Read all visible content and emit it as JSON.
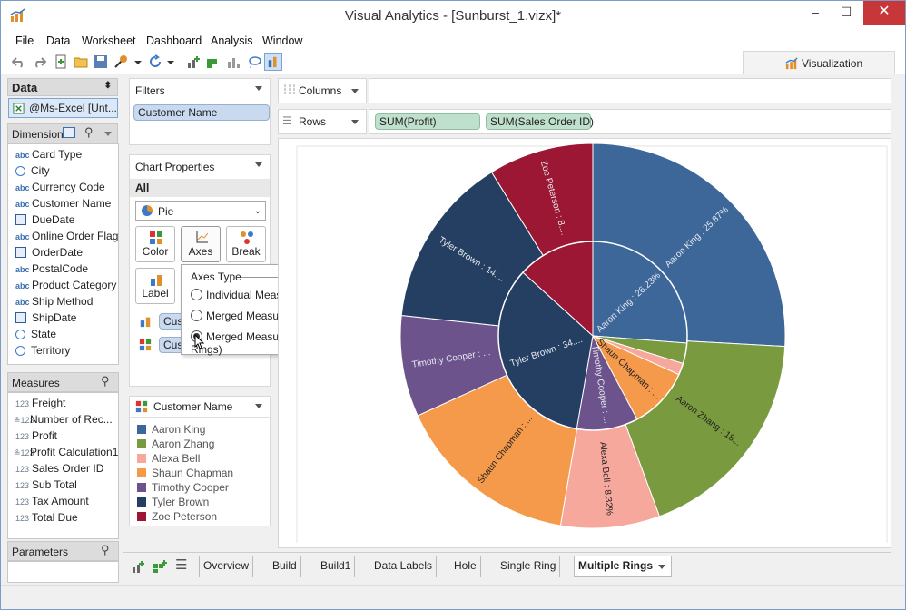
{
  "window": {
    "title": "Visual Analytics - [Sunburst_1.vizx]*",
    "minimize": "–",
    "maximize": "☐",
    "close": "✕"
  },
  "menu": [
    "File",
    "Data",
    "Worksheet",
    "Dashboard",
    "Analysis",
    "Window"
  ],
  "viz_tab": {
    "label": "Visualization"
  },
  "data_panel": {
    "title": "Data",
    "source": "@Ms-Excel [Unt..."
  },
  "dimensions": {
    "title": "Dimensions",
    "items": [
      {
        "label": "Card Type",
        "type": "abc"
      },
      {
        "label": "City",
        "type": "geo"
      },
      {
        "label": "Currency Code",
        "type": "abc"
      },
      {
        "label": "Customer Name",
        "type": "abc"
      },
      {
        "label": "DueDate",
        "type": "date"
      },
      {
        "label": "Online Order Flag",
        "type": "abc"
      },
      {
        "label": "OrderDate",
        "type": "date"
      },
      {
        "label": "PostalCode",
        "type": "abc"
      },
      {
        "label": "Product Category",
        "type": "abc"
      },
      {
        "label": "Ship Method",
        "type": "abc"
      },
      {
        "label": "ShipDate",
        "type": "date"
      },
      {
        "label": "State",
        "type": "geo"
      },
      {
        "label": "Territory",
        "type": "geo"
      }
    ]
  },
  "measures": {
    "title": "Measures",
    "items": [
      {
        "label": "Freight",
        "type": "123"
      },
      {
        "label": "Number of Rec...",
        "type": "calc"
      },
      {
        "label": "Profit",
        "type": "123"
      },
      {
        "label": "Profit Calculation1",
        "type": "calc"
      },
      {
        "label": "Sales Order ID",
        "type": "123"
      },
      {
        "label": "Sub Total",
        "type": "123"
      },
      {
        "label": "Tax Amount",
        "type": "123"
      },
      {
        "label": "Total Due",
        "type": "123"
      }
    ]
  },
  "parameters": {
    "title": "Parameters"
  },
  "filters": {
    "title": "Filters",
    "items": [
      "Customer Name"
    ]
  },
  "chart_properties": {
    "title": "Chart Properties",
    "scope": "All",
    "chart_type": "Pie",
    "buttons": {
      "color": "Color",
      "axes": "Axes",
      "break": "Break",
      "label": "Label"
    },
    "marks": [
      "Cust",
      "Cust"
    ]
  },
  "axes_popup": {
    "title": "Axes Type",
    "options": [
      {
        "label": "Individual Measures",
        "selected": false
      },
      {
        "label": "Merged Measures (Single Ring)",
        "selected": false
      },
      {
        "label": "Merged Measures (Multiple Rings)",
        "selected": true
      }
    ]
  },
  "legend": {
    "title": "Customer Name",
    "items": [
      {
        "label": "Aaron King",
        "color": "#3d6699"
      },
      {
        "label": "Aaron Zhang",
        "color": "#799a3e"
      },
      {
        "label": "Alexa Bell",
        "color": "#f5a89b"
      },
      {
        "label": "Shaun Chapman",
        "color": "#f5994a"
      },
      {
        "label": "Timothy Cooper",
        "color": "#6c538c"
      },
      {
        "label": "Tyler Brown",
        "color": "#253f63"
      },
      {
        "label": "Zoe Peterson",
        "color": "#9b1733"
      }
    ]
  },
  "shelves": {
    "columns_label": "Columns",
    "rows_label": "Rows",
    "rows_pills": [
      "SUM(Profit)",
      "SUM(Sales Order ID)"
    ]
  },
  "chart_data": {
    "type": "pie",
    "rings": [
      {
        "measure": "SUM(Sales Order ID)",
        "ring": "outer",
        "slices": [
          {
            "category": "Aaron King",
            "percent": 25.87,
            "label": "Aaron King : 25.87%"
          },
          {
            "category": "Aaron Zhang",
            "percent": 18.5,
            "label": "Aaron Zhang : 18..."
          },
          {
            "category": "Alexa Bell",
            "percent": 8.32,
            "label": "Alexa Bell : 8.32%"
          },
          {
            "category": "Shaun Chapman",
            "percent": 15.5,
            "label": "Shaun Chapman : ..."
          },
          {
            "category": "Timothy Cooper",
            "percent": 8.5,
            "label": "Timothy Cooper : ..."
          },
          {
            "category": "Tyler Brown",
            "percent": 14.5,
            "label": "Tyler Brown : 14...."
          },
          {
            "category": "Zoe Peterson",
            "percent": 8.81,
            "label": "Zoe Peterson : 8...."
          }
        ]
      },
      {
        "measure": "SUM(Profit)",
        "ring": "inner",
        "slices": [
          {
            "category": "Aaron King",
            "percent": 26.23,
            "label": "Aaron King : 26.23%"
          },
          {
            "category": "Aaron Zhang",
            "percent": 3.5,
            "label": ""
          },
          {
            "category": "Alexa Bell",
            "percent": 2.0,
            "label": ""
          },
          {
            "category": "Shaun Chapman",
            "percent": 10.5,
            "label": "Shaun Chapman : ..."
          },
          {
            "category": "Timothy Cooper",
            "percent": 10.5,
            "label": "Timothy Cooper : ..."
          },
          {
            "category": "Tyler Brown",
            "percent": 34.0,
            "label": "Tyler Brown : 34...."
          },
          {
            "category": "Zoe Peterson",
            "percent": 13.27,
            "label": ""
          }
        ]
      }
    ]
  },
  "sheet_tabs": [
    {
      "label": "Overview",
      "active": false
    },
    {
      "label": "Build",
      "active": false
    },
    {
      "label": "Build1",
      "active": false
    },
    {
      "label": "Data Labels",
      "active": false
    },
    {
      "label": "Hole",
      "active": false
    },
    {
      "label": "Single Ring",
      "active": false
    },
    {
      "label": "Multiple Rings",
      "active": true
    }
  ]
}
